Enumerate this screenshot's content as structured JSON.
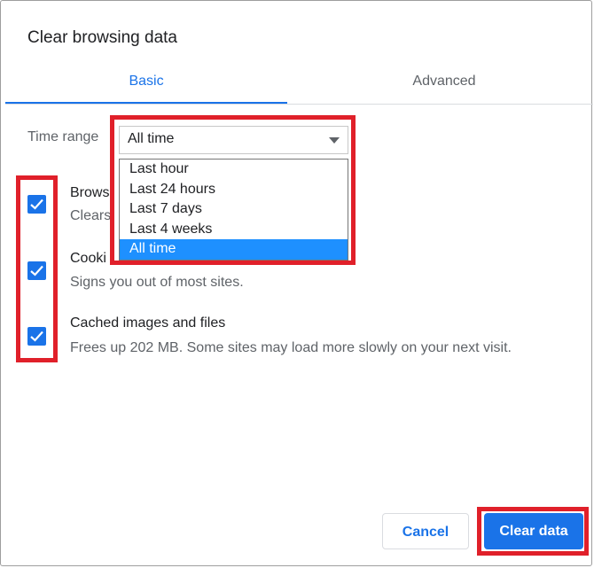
{
  "dialog": {
    "title": "Clear browsing data",
    "tabs": [
      {
        "label": "Basic",
        "active": true
      },
      {
        "label": "Advanced",
        "active": false
      }
    ],
    "time_range": {
      "label": "Time range",
      "selected": "All time",
      "options": [
        "Last hour",
        "Last 24 hours",
        "Last 7 days",
        "Last 4 weeks",
        "All time"
      ]
    },
    "items": [
      {
        "title": "Brows",
        "desc": "Clears",
        "checked": true
      },
      {
        "title": "Cooki",
        "desc": "Signs you out of most sites.",
        "checked": true
      },
      {
        "title": "Cached images and files",
        "desc": "Frees up 202 MB. Some sites may load more slowly on your next visit.",
        "checked": true
      }
    ],
    "buttons": {
      "cancel": "Cancel",
      "clear": "Clear data"
    }
  },
  "colors": {
    "accent": "#1a73e8",
    "highlight_box": "#e0202a",
    "option_selected": "#1e90ff"
  }
}
